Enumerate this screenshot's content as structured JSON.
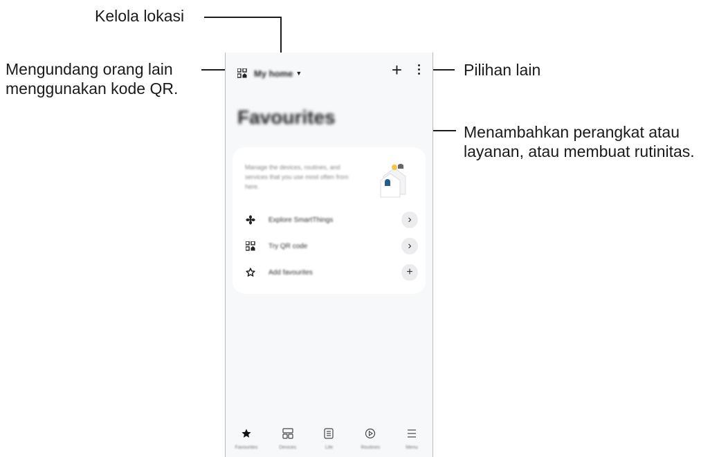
{
  "annotations": {
    "manage_location": "Kelola lokasi",
    "invite_line1": "Mengundang orang lain",
    "invite_line2": "menggunakan kode QR.",
    "more_options": "Pilihan lain",
    "add_line1": "Menambahkan perangkat atau",
    "add_line2": "layanan, atau membuat rutinitas."
  },
  "app": {
    "location_name": "My home",
    "page_title": "Favourites",
    "card": {
      "description": "Manage the devices, routines, and services that you use most often from here.",
      "rows": [
        {
          "label": "Explore SmartThings",
          "icon": "fan-icon",
          "action": "chevron-right"
        },
        {
          "label": "Try QR code",
          "icon": "qr-code-icon",
          "action": "chevron-right"
        },
        {
          "label": "Add favourites",
          "icon": "star-outline-icon",
          "action": "plus"
        }
      ]
    },
    "nav": [
      {
        "label": "Favourites",
        "icon": "star-filled-icon",
        "active": true
      },
      {
        "label": "Devices",
        "icon": "devices-grid-icon",
        "active": false
      },
      {
        "label": "Life",
        "icon": "life-icon",
        "active": false
      },
      {
        "label": "Routines",
        "icon": "play-circle-icon",
        "active": false
      },
      {
        "label": "Menu",
        "icon": "menu-icon",
        "active": false
      }
    ]
  }
}
